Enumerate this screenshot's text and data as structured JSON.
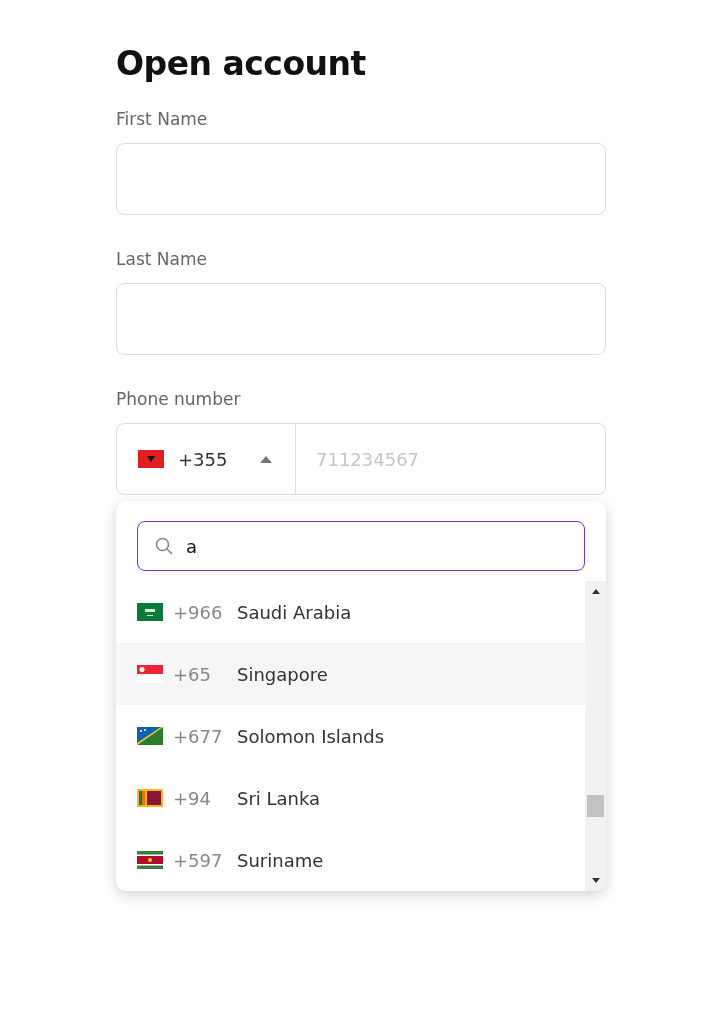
{
  "title": "Open account",
  "fields": [
    {
      "label": "First Name"
    },
    {
      "label": "Last Name"
    }
  ],
  "phone": {
    "label": "Phone number",
    "kind": "al",
    "code": "+355",
    "expanded": true,
    "placeholder": "711234567"
  },
  "dropdown": {
    "search": "a",
    "countries": [
      {
        "kind": "sa",
        "code": "+966",
        "name": "Saudi Arabia",
        "selected": false
      },
      {
        "kind": "sg",
        "code": "+65",
        "name": "Singapore",
        "selected": true
      },
      {
        "kind": "sb",
        "code": "+677",
        "name": "Solomon Islands",
        "selected": false
      },
      {
        "kind": "lk",
        "code": "+94",
        "name": "Sri Lanka",
        "selected": false
      },
      {
        "kind": "sr",
        "code": "+597",
        "name": "Suriname",
        "selected": false
      }
    ]
  }
}
